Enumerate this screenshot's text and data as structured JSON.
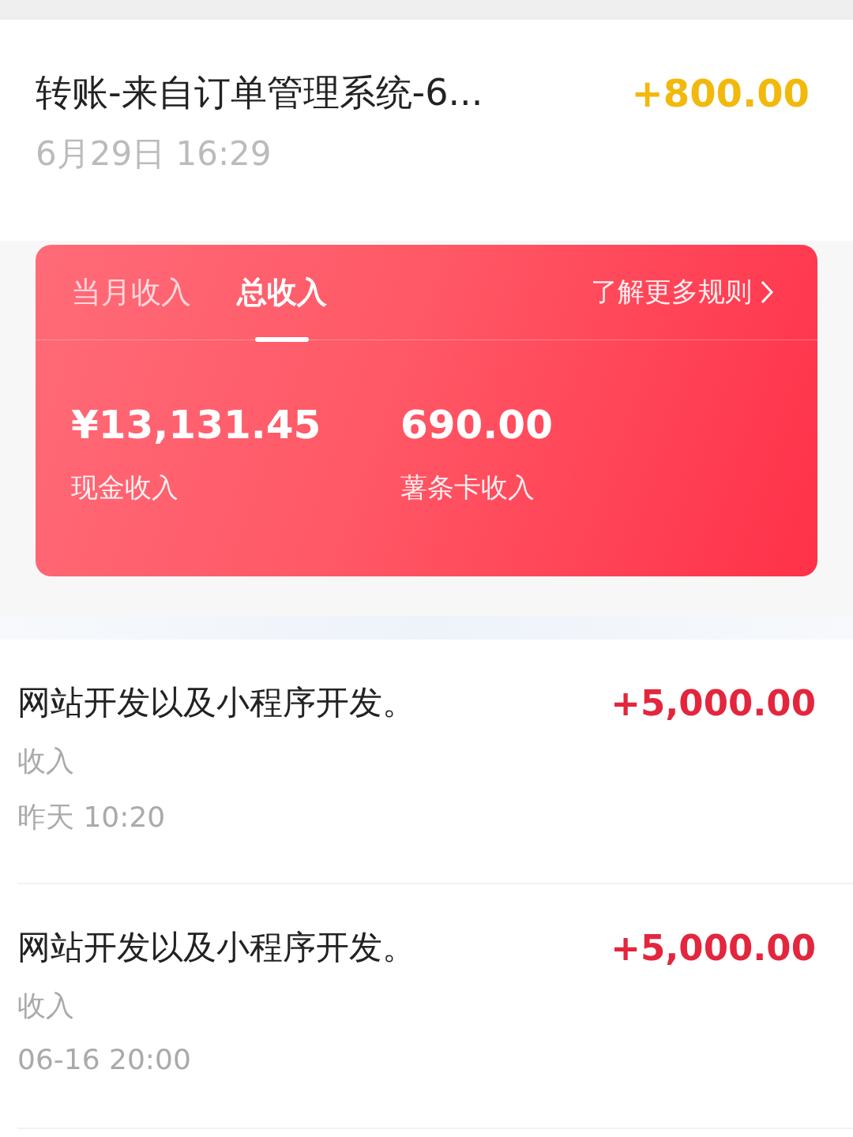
{
  "top_transaction": {
    "title": "转账-来自订单管理系统-6...",
    "amount": "+800.00",
    "time": "6月29日 16:29"
  },
  "income_card": {
    "tabs": [
      {
        "label": "当月收入",
        "selected": false
      },
      {
        "label": "总收入",
        "selected": true
      }
    ],
    "rules_link": "了解更多规则",
    "stats": [
      {
        "value": "¥13,131.45",
        "label": "现金收入"
      },
      {
        "value": "690.00",
        "label": "薯条卡收入"
      }
    ]
  },
  "transactions": [
    {
      "title": "网站开发以及小程序开发。",
      "amount": "+5,000.00",
      "type": "收入",
      "time": "昨天 10:20"
    },
    {
      "title": "网站开发以及小程序开发。",
      "amount": "+5,000.00",
      "type": "收入",
      "time": "06-16 20:00"
    }
  ]
}
